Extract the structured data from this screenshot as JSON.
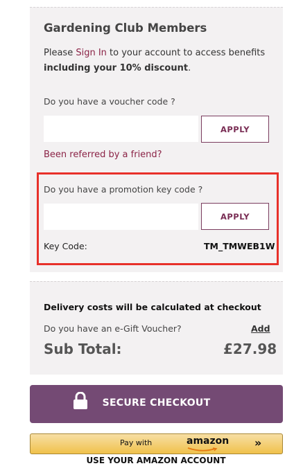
{
  "members": {
    "title": "Gardening Club Members",
    "intro_prefix": "Please ",
    "sign_in_link": "Sign In",
    "intro_suffix": " to your account to access benefits",
    "intro_bold": "including your 10% discount",
    "intro_end": "."
  },
  "voucher": {
    "question": "Do you have a voucher code ?",
    "value": "",
    "apply_label": "APPLY",
    "referral_link": "Been referred by a friend?"
  },
  "promotion": {
    "question": "Do you have a promotion key code ?",
    "value": "",
    "apply_label": "APPLY",
    "key_code_label": "Key Code:",
    "key_code_value": "TM_TMWEB1W"
  },
  "summary": {
    "delivery_note": "Delivery costs will be calculated at checkout",
    "egift_question": "Do you have an e-Gift Voucher?",
    "add_link": "Add",
    "subtotal_label": "Sub Total:",
    "subtotal_value": "£27.98"
  },
  "checkout": {
    "label": "SECURE CHECKOUT",
    "icon": "lock-icon",
    "color": "#744a74"
  },
  "amazon_pay": {
    "pay_with": "Pay with",
    "brand": "amazon",
    "chevron": "»",
    "caption": "USE YOUR AMAZON ACCOUNT"
  },
  "colors": {
    "link": "#8b2346",
    "highlight_border": "#e8302a",
    "panel_bg": "#f3f1f2"
  }
}
